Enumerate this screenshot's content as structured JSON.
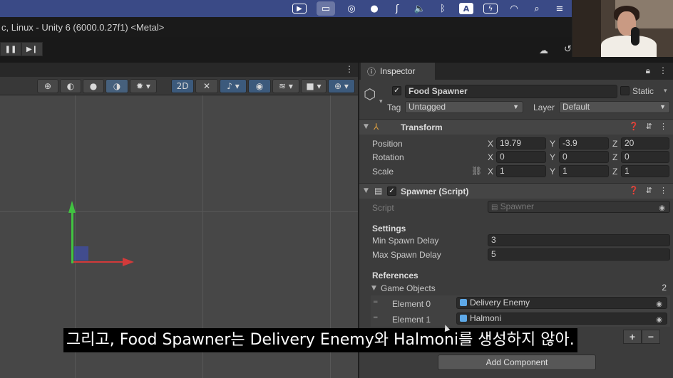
{
  "window": {
    "title": "c, Linux - Unity 6 (6000.0.27f1) <Metal>"
  },
  "menubar": {
    "icons": [
      "screen-record-icon",
      "display-icon",
      "accessibility-icon",
      "g-app-icon",
      "hearing-icon",
      "volume-icon",
      "bluetooth-icon",
      "input-source-icon",
      "battery-icon",
      "wifi-icon",
      "spotlight-icon",
      "control-center-icon"
    ],
    "input_source_label": "A"
  },
  "toolbar": {
    "pause_glyph": "❚❚",
    "step_glyph": "▶❙",
    "cloud_glyph": "☁",
    "history_glyph": "↺"
  },
  "scene": {
    "menu_glyph": "⋮",
    "tools": {
      "mode_2d": "2D"
    },
    "colors": {
      "y_axis": "#41c341",
      "x_axis": "#d23a3a",
      "background": "#474747"
    }
  },
  "inspector": {
    "tab_label": "Inspector",
    "lock_glyph": "🔒",
    "menu_glyph": "⋮",
    "object": {
      "name": "Food Spawner",
      "static_label": "Static",
      "tag_label": "Tag",
      "tag_value": "Untagged",
      "layer_label": "Layer",
      "layer_value": "Default"
    },
    "transform": {
      "title": "Transform",
      "rows": [
        {
          "label": "Position",
          "x": "19.79",
          "y": "-3.9",
          "z": "20"
        },
        {
          "label": "Rotation",
          "x": "0",
          "y": "0",
          "z": "0"
        },
        {
          "label": "Scale",
          "x": "1",
          "y": "1",
          "z": "1"
        }
      ],
      "axis_x": "X",
      "axis_y": "Y",
      "axis_z": "Z"
    },
    "spawner": {
      "title": "Spawner (Script)",
      "script_label": "Script",
      "script_value": "Spawner",
      "settings_header": "Settings",
      "min_label": "Min Spawn Delay",
      "min_value": "3",
      "max_label": "Max Spawn Delay",
      "max_value": "5",
      "references_header": "References",
      "game_objects_label": "Game Objects",
      "game_objects_count": "2",
      "elements": [
        {
          "label": "Element 0",
          "value": "Delivery Enemy"
        },
        {
          "label": "Element 1",
          "value": "Halmoni"
        }
      ],
      "plus": "+",
      "minus": "−"
    },
    "add_component": "Add Component"
  },
  "subtitle": "그리고, Food Spawner는 Delivery Enemy와 Halmoni를 생성하지 않아."
}
